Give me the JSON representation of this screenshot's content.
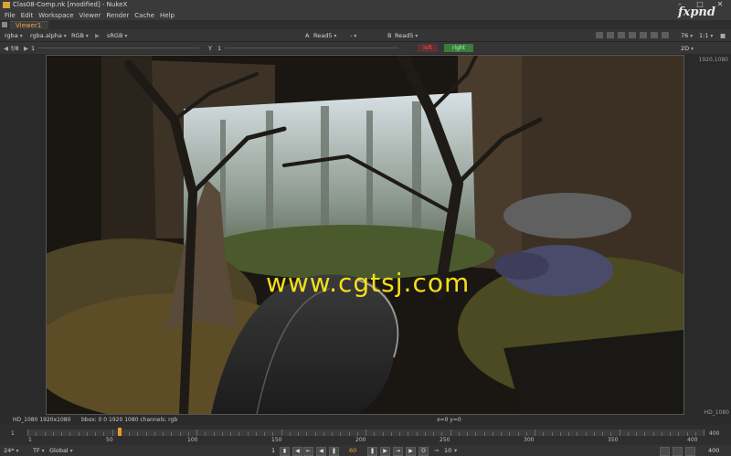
{
  "window": {
    "title": "Clas08-Comp.nk [modified] - NukeX"
  },
  "menu": [
    "File",
    "Edit",
    "Workspace",
    "Viewer",
    "Render",
    "Cache",
    "Help"
  ],
  "watermark_logo": "fxpnd",
  "viewer_tab": "Viewer1",
  "toolbar": {
    "channels": "rgba",
    "alpha_channel": "rgba.alpha",
    "display": "RGB",
    "lut": "sRGB",
    "a_input_label": "A",
    "a_input": "Read5",
    "wipe_op": "-",
    "b_input_label": "B",
    "b_input": "Read5",
    "zoom": "76",
    "ratio": "1:1",
    "view_mode": "2D"
  },
  "toolbar2": {
    "fstop": "f/8",
    "gain": "1",
    "gamma_label": "Y",
    "gamma": "1",
    "left_button": "left",
    "right_button": "right"
  },
  "viewer": {
    "format_top": "1920,1080",
    "format_bottom": "HD_1080",
    "overlay_text": "www.cgtsj.com"
  },
  "info": {
    "format": "HD_1080 1920x1080",
    "bbox": "bbox: 0 0 1920 1080 channels: rgb",
    "coords": "x=0 y=0"
  },
  "timeline": {
    "start": "1",
    "end": "400",
    "end_right": "400",
    "ticks": [
      "50",
      "100",
      "150",
      "200",
      "250",
      "300",
      "350"
    ],
    "current_frame_fraction": 0.136
  },
  "controls": {
    "fps": "24*",
    "tf": "TF",
    "range": "Global",
    "in_frame": "1",
    "current_frame": "60",
    "step": "10",
    "out_frame": "400"
  },
  "colors": {
    "accent": "#e39b2b",
    "left_red": "#ff4a4a",
    "right_green": "#3d7a3d",
    "watermark": "#f5df1a"
  }
}
